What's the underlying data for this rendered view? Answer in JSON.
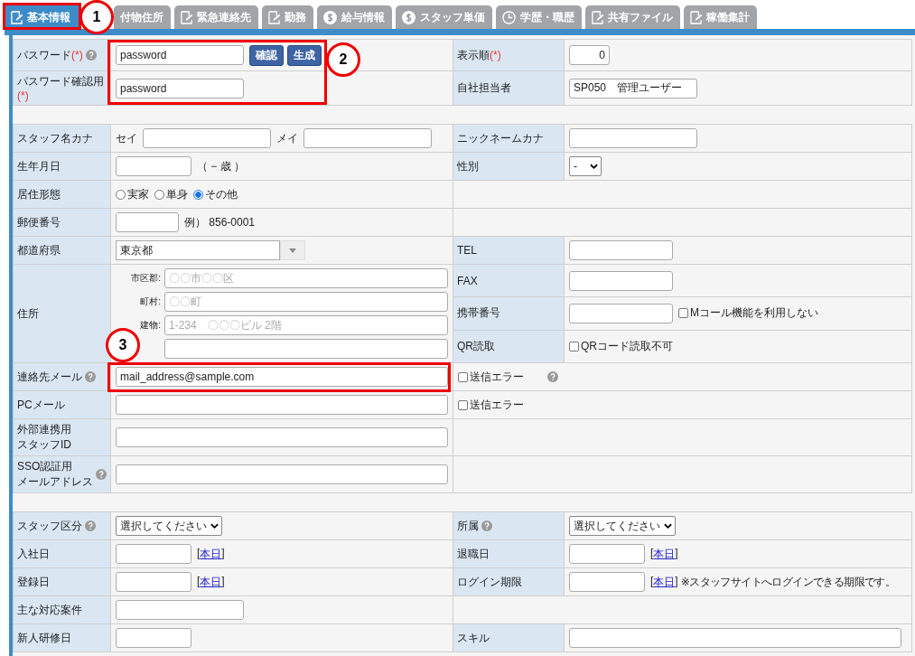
{
  "tabs": [
    {
      "label": "基本情報",
      "kind": "edit",
      "selected": true
    },
    {
      "label": "付物住所",
      "kind": "plain",
      "selected": false
    },
    {
      "label": "緊急連絡先",
      "kind": "edit",
      "selected": false
    },
    {
      "label": "勤務",
      "kind": "edit",
      "selected": false
    },
    {
      "label": "給与情報",
      "kind": "money",
      "selected": false
    },
    {
      "label": "スタッフ単価",
      "kind": "money",
      "selected": false
    },
    {
      "label": "学歴・職歴",
      "kind": "history",
      "selected": false
    },
    {
      "label": "共有ファイル",
      "kind": "edit",
      "selected": false
    },
    {
      "label": "稼働集計",
      "kind": "edit",
      "selected": false
    }
  ],
  "sections": [
    {
      "rows": [
        {
          "left": {
            "label": {
              "text": "パスワード",
              "mark": "(*)",
              "help": true
            },
            "items": [
              {
                "kind": "text",
                "value": "password"
              },
              {
                "kind": "button",
                "text": "確認"
              },
              {
                "kind": "button",
                "text": "生成"
              }
            ]
          },
          "right": [
            {
              "label": {
                "text": "表示順",
                "mark": "(*)"
              },
              "items": [
                {
                  "kind": "number",
                  "value": "0"
                }
              ]
            }
          ]
        },
        {
          "left": {
            "label": {
              "text": "パスワード確認用",
              "mark": "(*)"
            },
            "items": [
              {
                "kind": "text",
                "value": "password"
              }
            ]
          },
          "right": [
            {
              "label": {
                "text": "自社担当者"
              },
              "items": [
                {
                  "kind": "text",
                  "value": "SP050　管理ユーザー"
                }
              ]
            }
          ]
        }
      ]
    },
    {
      "rows": [
        {
          "left": {
            "label": {
              "text": "スタッフ名カナ"
            },
            "items": [
              {
                "kind": "note",
                "text": "セイ"
              },
              {
                "kind": "name"
              },
              {
                "kind": "note",
                "text": "メイ"
              },
              {
                "kind": "name"
              }
            ]
          },
          "right": [
            {
              "label": {
                "text": "ニックネームカナ"
              },
              "items": [
                {
                  "kind": "text"
                }
              ]
            }
          ]
        },
        {
          "left": {
            "label": {
              "text": "生年月日"
            },
            "items": [
              {
                "kind": "date"
              },
              {
                "kind": "note",
                "text": "（ − 歳 ）"
              }
            ]
          },
          "right": [
            {
              "label": {
                "text": "性別"
              },
              "items": [
                {
                  "kind": "select",
                  "value": "-"
                }
              ]
            }
          ]
        },
        {
          "left": {
            "label": {
              "text": "居住形態"
            },
            "items": [
              {
                "kind": "radio",
                "text": "実家",
                "selected": false
              },
              {
                "kind": "radio",
                "text": "単身",
                "selected": false
              },
              {
                "kind": "radio",
                "text": "その他",
                "selected": true
              }
            ]
          }
        },
        {
          "left": {
            "label": {
              "text": "郵便番号"
            },
            "items": [
              {
                "kind": "zip"
              },
              {
                "kind": "note",
                "text": "例）  856-0001"
              }
            ]
          }
        },
        {
          "left": {
            "label": {
              "text": "都道府県"
            },
            "items": [
              {
                "kind": "combo",
                "value": "東京都"
              }
            ]
          },
          "right": [
            {
              "label": {
                "text": "TEL"
              },
              "items": [
                {
                  "kind": "short"
                }
              ]
            }
          ]
        },
        {
          "left": {
            "label": {
              "text": "住所"
            },
            "items": [
              {
                "kind": "line",
                "text": "市区郡:",
                "placeholder": "〇〇市〇〇区"
              },
              {
                "kind": "line",
                "text": "町村:",
                "placeholder": "〇〇町"
              },
              {
                "kind": "line",
                "text": "建物:",
                "placeholder": "1-234　〇〇〇ビル 2階"
              },
              {
                "kind": "line"
              }
            ]
          },
          "right": [
            {
              "label": {
                "text": "FAX"
              },
              "items": [
                {
                  "kind": "short"
                }
              ]
            },
            {
              "label": {
                "text": "携帯番号"
              },
              "items": [
                {
                  "kind": "short"
                },
                {
                  "kind": "checkbox",
                  "text": "Mコール機能を利用しない",
                  "checked": false
                }
              ]
            },
            {
              "label": {
                "text": "QR読取"
              },
              "items": [
                {
                  "kind": "checkbox",
                  "text": "QRコード読取不可",
                  "checked": false
                }
              ]
            }
          ]
        },
        {
          "left": {
            "label": {
              "text": "連絡先メール",
              "help": true
            },
            "items": [
              {
                "kind": "wide",
                "value": "mail_address@sample.com"
              }
            ]
          },
          "right": [
            {
              "items": [
                {
                  "kind": "checkbox",
                  "text": "送信エラー",
                  "checked": false
                },
                {
                  "kind": "help"
                }
              ]
            }
          ]
        },
        {
          "left": {
            "label": {
              "text": "PCメール"
            },
            "items": [
              {
                "kind": "wide"
              }
            ]
          },
          "right": [
            {
              "items": [
                {
                  "kind": "checkbox",
                  "text": "送信エラー",
                  "checked": false
                }
              ]
            }
          ]
        },
        {
          "left": {
            "label": {
              "lines": [
                "外部連携用",
                "スタッフID"
              ]
            },
            "items": [
              {
                "kind": "wide"
              }
            ]
          }
        },
        {
          "left": {
            "label": {
              "lines": [
                "SSO認証用",
                "メールアドレス"
              ],
              "help": true
            },
            "items": [
              {
                "kind": "wide"
              }
            ]
          }
        }
      ]
    },
    {
      "rows": [
        {
          "left": {
            "label": {
              "text": "スタッフ区分",
              "help": true
            },
            "items": [
              {
                "kind": "select",
                "value": "選択してください"
              }
            ]
          },
          "right": [
            {
              "label": {
                "text": "所属",
                "help": true
              },
              "items": [
                {
                  "kind": "select",
                  "value": "選択してください"
                }
              ]
            }
          ]
        },
        {
          "left": {
            "label": {
              "text": "入社日"
            },
            "items": [
              {
                "kind": "date"
              },
              {
                "kind": "link",
                "text": "本日",
                "open": "[",
                "close": "]"
              }
            ]
          },
          "right": [
            {
              "label": {
                "text": "退職日"
              },
              "items": [
                {
                  "kind": "date"
                },
                {
                  "kind": "link",
                  "text": "本日",
                  "open": "[",
                  "close": "]"
                }
              ]
            }
          ]
        },
        {
          "left": {
            "label": {
              "text": "登録日"
            },
            "items": [
              {
                "kind": "date"
              },
              {
                "kind": "link",
                "text": "本日",
                "open": "[",
                "close": "]"
              }
            ]
          },
          "right": [
            {
              "label": {
                "text": "ログイン期限"
              },
              "items": [
                {
                  "kind": "date"
                },
                {
                  "kind": "link",
                  "text": "本日",
                  "open": "[",
                  "close": "]"
                },
                {
                  "kind": "note",
                  "text": "※スタッフサイトへログインできる期限です。"
                }
              ]
            }
          ]
        },
        {
          "left": {
            "label": {
              "text": "主な対応案件"
            },
            "items": [
              {
                "kind": "text"
              }
            ]
          }
        },
        {
          "left": {
            "label": {
              "text": "新人研修日"
            },
            "items": [
              {
                "kind": "date"
              }
            ]
          },
          "right": [
            {
              "label": {
                "text": "スキル"
              },
              "items": [
                {
                  "kind": "wide"
                }
              ]
            }
          ]
        }
      ]
    }
  ],
  "annotations": [
    {
      "number": "1"
    },
    {
      "number": "2"
    },
    {
      "number": "3"
    }
  ]
}
